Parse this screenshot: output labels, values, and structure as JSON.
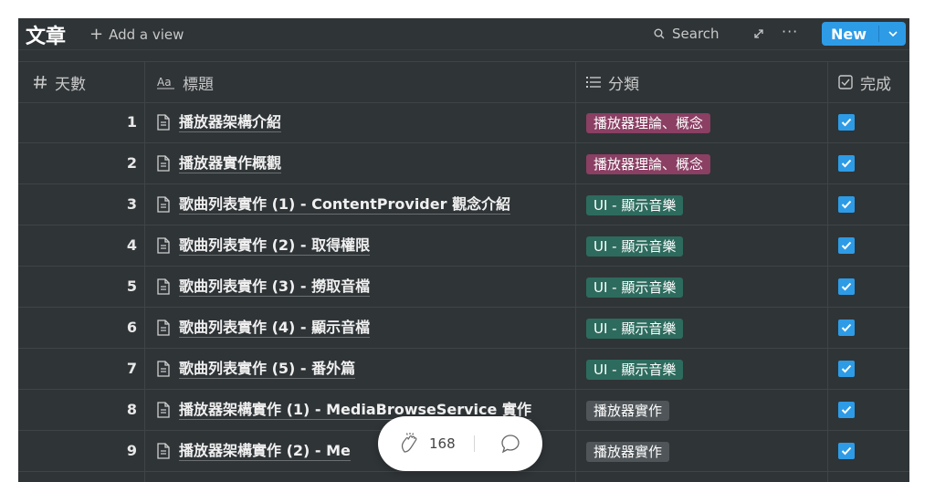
{
  "header": {
    "title": "文章",
    "add_view_label": "Add a view",
    "search_label": "Search",
    "more_label": "···",
    "new_label": "New"
  },
  "columns": {
    "days": "天數",
    "title": "標題",
    "category": "分類",
    "done": "完成"
  },
  "rows": [
    {
      "num": "1",
      "title": "播放器架構介紹",
      "category": "播放器理論、概念",
      "done": true
    },
    {
      "num": "2",
      "title": "播放器實作概觀",
      "category": "播放器理論、概念",
      "done": true
    },
    {
      "num": "3",
      "title": "歌曲列表實作 (1) - ContentProvider 觀念介紹",
      "category": "UI - 顯示音樂",
      "done": true
    },
    {
      "num": "4",
      "title": "歌曲列表實作 (2) - 取得權限",
      "category": "UI - 顯示音樂",
      "done": true
    },
    {
      "num": "5",
      "title": "歌曲列表實作 (3) - 撈取音檔",
      "category": "UI - 顯示音樂",
      "done": true
    },
    {
      "num": "6",
      "title": "歌曲列表實作 (4) - 顯示音檔",
      "category": "UI - 顯示音樂",
      "done": true
    },
    {
      "num": "7",
      "title": "歌曲列表實作 (5) - 番外篇",
      "category": "UI - 顯示音樂",
      "done": true
    },
    {
      "num": "8",
      "title": "播放器架構實作 (1) - MediaBrowseService 實作",
      "category": "播放器實作",
      "done": true
    },
    {
      "num": "9",
      "title": "播放器架構實作 (2) - Me",
      "category": "播放器實作",
      "done": true
    }
  ],
  "tag_colors": {
    "播放器理論、概念": "#8a3f63",
    "UI - 顯示音樂": "#2d6b5e",
    "播放器實作": "#4f5558"
  },
  "colors": {
    "accent": "#2e9be6",
    "panel_bg": "#2f3437"
  },
  "pill": {
    "clap_count": "168"
  },
  "icons": {
    "days_col": "hash-icon",
    "title_col": "text-type-icon",
    "category_col": "list-icon",
    "done_col": "checkbox-icon",
    "row": "page-icon"
  }
}
